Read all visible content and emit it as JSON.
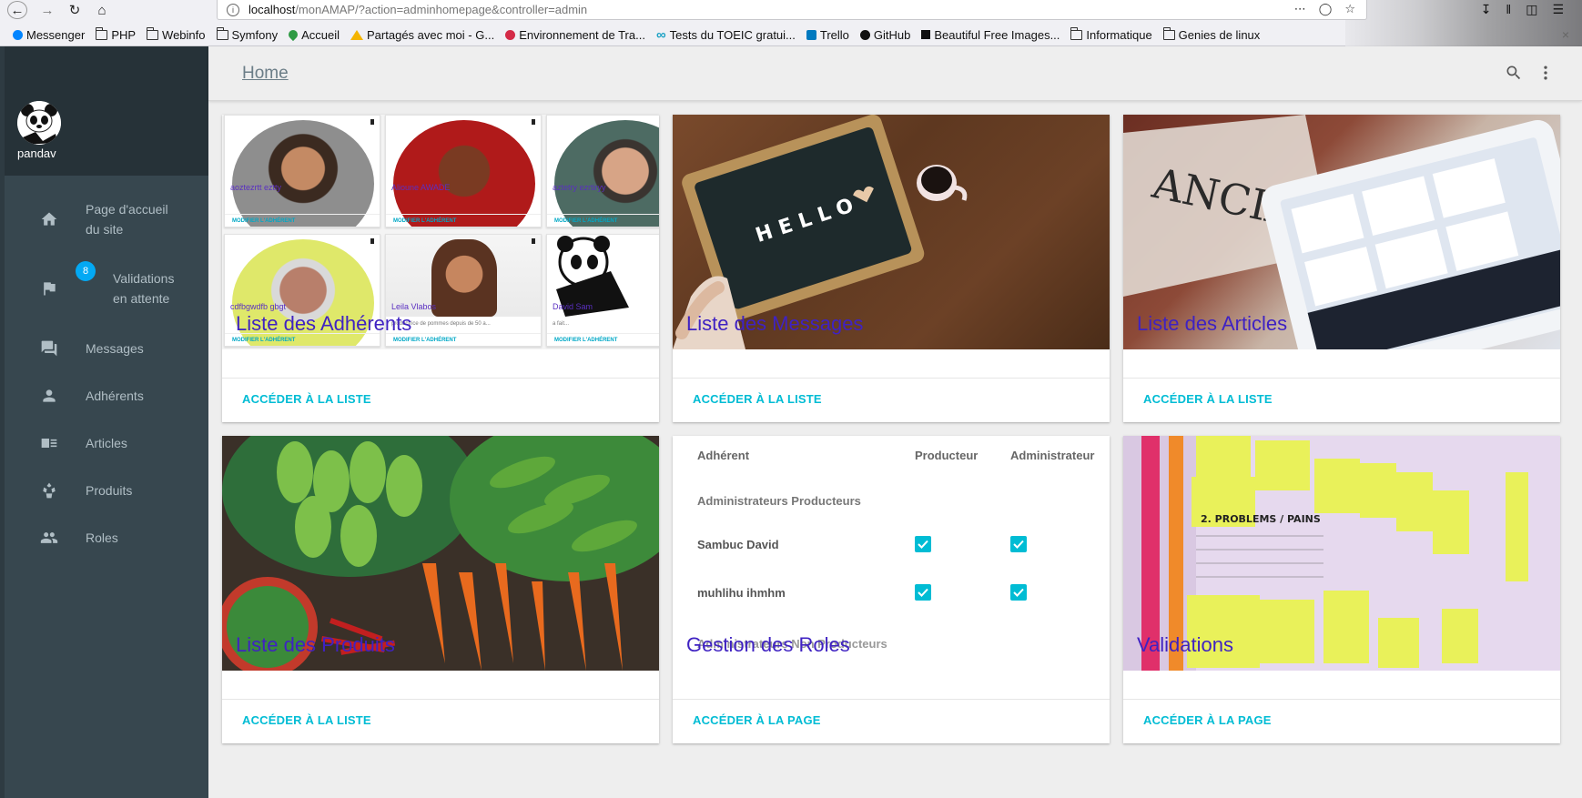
{
  "browser": {
    "url_host": "localhost",
    "url_path": "/monAMAP/?action=adminhomepage&controller=admin",
    "bookmarks": [
      {
        "label": "Messenger",
        "icon": "messenger-icon"
      },
      {
        "label": "PHP",
        "icon": "folder-icon"
      },
      {
        "label": "Webinfo",
        "icon": "folder-icon"
      },
      {
        "label": "Symfony",
        "icon": "folder-icon"
      },
      {
        "label": "Accueil",
        "icon": "drop-icon"
      },
      {
        "label": "Partagés avec moi - G...",
        "icon": "drive-icon"
      },
      {
        "label": "Environnement de Tra...",
        "icon": "red-circle-icon"
      },
      {
        "label": "Tests du TOEIC gratui...",
        "icon": "infinity-icon"
      },
      {
        "label": "Trello",
        "icon": "trello-icon"
      },
      {
        "label": "GitHub",
        "icon": "github-icon"
      },
      {
        "label": "Beautiful Free Images...",
        "icon": "unsplash-icon"
      },
      {
        "label": "Informatique",
        "icon": "folder-icon"
      },
      {
        "label": "Genies de linux",
        "icon": "folder-icon"
      }
    ]
  },
  "sidebar": {
    "username": "pandav",
    "items": [
      {
        "label_1": "Page d'accueil",
        "label_2": "du site",
        "icon": "home-icon"
      },
      {
        "label_1": "Validations",
        "label_2": "en attente",
        "icon": "flag-icon",
        "badge": "8"
      },
      {
        "label": "Messages",
        "icon": "message-icon"
      },
      {
        "label": "Adhérents",
        "icon": "person-icon"
      },
      {
        "label": "Articles",
        "icon": "article-icon"
      },
      {
        "label": "Produits",
        "icon": "product-icon"
      },
      {
        "label": "Roles",
        "icon": "group-icon"
      }
    ]
  },
  "header": {
    "title": "Home"
  },
  "cards": [
    {
      "title": "Liste des Adhérents",
      "action": "ACCÉDER À LA LISTE"
    },
    {
      "title": "Liste des Messages",
      "action": "ACCÉDER À LA LISTE"
    },
    {
      "title": "Liste des Articles",
      "action": "ACCÉDER À LA LISTE"
    },
    {
      "title": "Liste des Produits",
      "action": "ACCÉDER À LA LISTE"
    },
    {
      "title": "Gestion des Roles",
      "action": "ACCÉDER À LA PAGE"
    },
    {
      "title": "Validations",
      "action": "ACCÉDER À LA PAGE"
    }
  ],
  "adherents_preview": [
    {
      "name": "aoztezrtt eztty",
      "button": "MODIFIER L'ADHÉRENT"
    },
    {
      "name": "Alioune AWADE",
      "button": "MODIFIER L'ADHÉRENT"
    },
    {
      "name": "aztetry ezrtiryy",
      "button": "MODIFIER L'ADHÉRENT"
    },
    {
      "name": "cdfbgwdfb gbgt",
      "button": "MODIFIER L'ADHÉRENT"
    },
    {
      "name": "Leila Vlabos",
      "desc": "productrice de pommes depuis de 50 a...",
      "button": "MODIFIER L'ADHÉRENT"
    },
    {
      "name": "David Sam",
      "desc": "a fait...",
      "button": "MODIFIER L'ADHÉRENT"
    }
  ],
  "roles_preview": {
    "headers": [
      "Adhérent",
      "Producteur",
      "Administrateur"
    ],
    "group": "Administrateurs Producteurs",
    "rows": [
      {
        "name": "Sambuc David",
        "producteur": true,
        "administrateur": true
      },
      {
        "name": "muhlihu ihmhm",
        "producteur": true,
        "administrateur": true
      }
    ],
    "footer_group": "Administrateurs Non Producteurs"
  },
  "colors": {
    "sidebar": "#37474f",
    "sidebar_head": "#263238",
    "accent": "#00bcd4",
    "badge": "#03a9f4",
    "card_title": "#3f22c2"
  }
}
